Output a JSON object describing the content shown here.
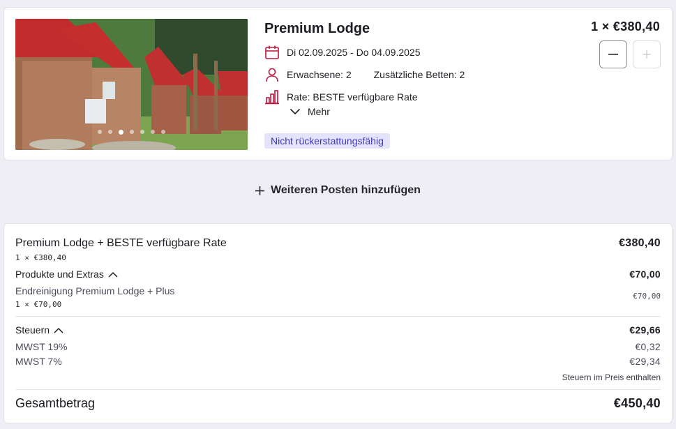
{
  "room": {
    "title": "Premium Lodge",
    "dates": "Di 02.09.2025 - Do 04.09.2025",
    "adults": "Erwachsene: 2",
    "extra_beds": "Zusätzliche Betten: 2",
    "rate": "Rate: BESTE verfügbare Rate",
    "more_label": "Mehr",
    "badge": "Nicht rückerstattungsfähig",
    "qty_price": "1 × €380,40",
    "minus_symbol": "−",
    "plus_symbol": "+"
  },
  "add_item": {
    "label": "Weiteren Posten hinzufügen"
  },
  "summary": {
    "room_line": {
      "label": "Premium Lodge + BESTE verfügbare Rate",
      "sub": "1 × €380,40",
      "amount": "€380,40"
    },
    "extras": {
      "label": "Produkte und Extras",
      "amount": "€70,00",
      "item_label": "Endreinigung Premium Lodge + Plus",
      "item_sub": "1 × €70,00",
      "item_amount": "€70,00"
    },
    "taxes": {
      "label": "Steuern",
      "amount": "€29,66",
      "lines": [
        {
          "label": "MWST 19%",
          "amount": "€0,32"
        },
        {
          "label": "MWST 7%",
          "amount": "€29,34"
        }
      ],
      "note": "Steuern im Preis enthalten"
    },
    "total": {
      "label": "Gesamtbetrag",
      "amount": "€450,40"
    }
  },
  "colors": {
    "accent": "#c0143c",
    "badge_bg": "#e4e3fb",
    "badge_text": "#3d3bb3",
    "page_bg": "#efeef4"
  }
}
